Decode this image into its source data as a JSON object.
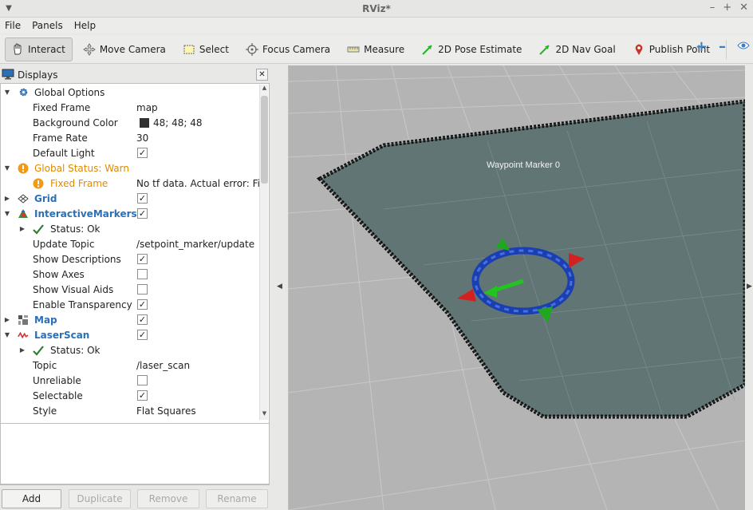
{
  "window": {
    "title": "RViz*"
  },
  "menu": {
    "file": "File",
    "panels": "Panels",
    "help": "Help"
  },
  "toolbar": {
    "interact": "Interact",
    "move_camera": "Move Camera",
    "select": "Select",
    "focus_camera": "Focus Camera",
    "measure": "Measure",
    "pose_estimate": "2D Pose Estimate",
    "nav_goal": "2D Nav Goal",
    "publish_point": "Publish Point"
  },
  "displays": {
    "title": "Displays",
    "rows": [
      {
        "label": "Global Options",
        "value": ""
      },
      {
        "label": "Fixed Frame",
        "value": "map"
      },
      {
        "label": "Background Color",
        "value": "48; 48; 48"
      },
      {
        "label": "Frame Rate",
        "value": "30"
      },
      {
        "label": "Default Light",
        "value": ""
      },
      {
        "label": "Global Status: Warn",
        "value": ""
      },
      {
        "label": "Fixed Frame",
        "value": "No tf data.  Actual error: Fix"
      },
      {
        "label": "Grid",
        "value": ""
      },
      {
        "label": "InteractiveMarkers",
        "value": ""
      },
      {
        "label": "Status: Ok",
        "value": ""
      },
      {
        "label": "Update Topic",
        "value": "/setpoint_marker/update"
      },
      {
        "label": "Show Descriptions",
        "value": ""
      },
      {
        "label": "Show Axes",
        "value": ""
      },
      {
        "label": "Show Visual Aids",
        "value": ""
      },
      {
        "label": "Enable Transparency",
        "value": ""
      },
      {
        "label": "Map",
        "value": ""
      },
      {
        "label": "LaserScan",
        "value": ""
      },
      {
        "label": "Status: Ok",
        "value": ""
      },
      {
        "label": "Topic",
        "value": "/laser_scan"
      },
      {
        "label": "Unreliable",
        "value": ""
      },
      {
        "label": "Selectable",
        "value": ""
      },
      {
        "label": "Style",
        "value": "Flat Squares"
      }
    ]
  },
  "buttons": {
    "add": "Add",
    "duplicate": "Duplicate",
    "remove": "Remove",
    "rename": "Rename"
  },
  "viewport": {
    "marker_label": "Waypoint  Marker  0"
  },
  "colors": {
    "background_swatch": "#303030",
    "warn": "#e08a00",
    "link": "#2b6fb6"
  },
  "icons": [
    "monitor-icon",
    "gear-icon",
    "warning-icon",
    "grid-icon",
    "marker-icon",
    "check-icon",
    "map-icon",
    "laser-icon",
    "hand-icon",
    "camera-move-icon",
    "select-icon",
    "focus-icon",
    "measure-icon",
    "pose-arrow-icon",
    "goal-arrow-icon",
    "pin-icon",
    "plus-icon",
    "minus-icon",
    "eye-icon"
  ]
}
